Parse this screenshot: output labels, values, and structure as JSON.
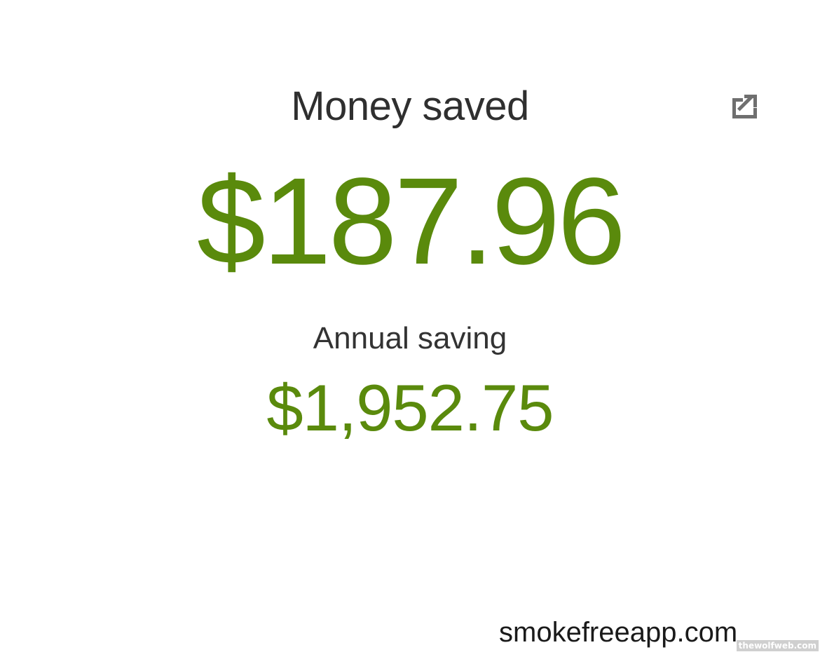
{
  "card": {
    "title": "Money saved",
    "amount": "$187.96",
    "sub_label": "Annual saving",
    "sub_amount": "$1,952.75",
    "share_icon": "share-export-icon"
  },
  "footer": {
    "site": "smokefreeapp.com",
    "watermark": "thewolfweb.com"
  },
  "colors": {
    "accent_green": "#5a8a0c",
    "text_dark": "#2f2f2f",
    "icon_gray": "#6f6f6f"
  }
}
